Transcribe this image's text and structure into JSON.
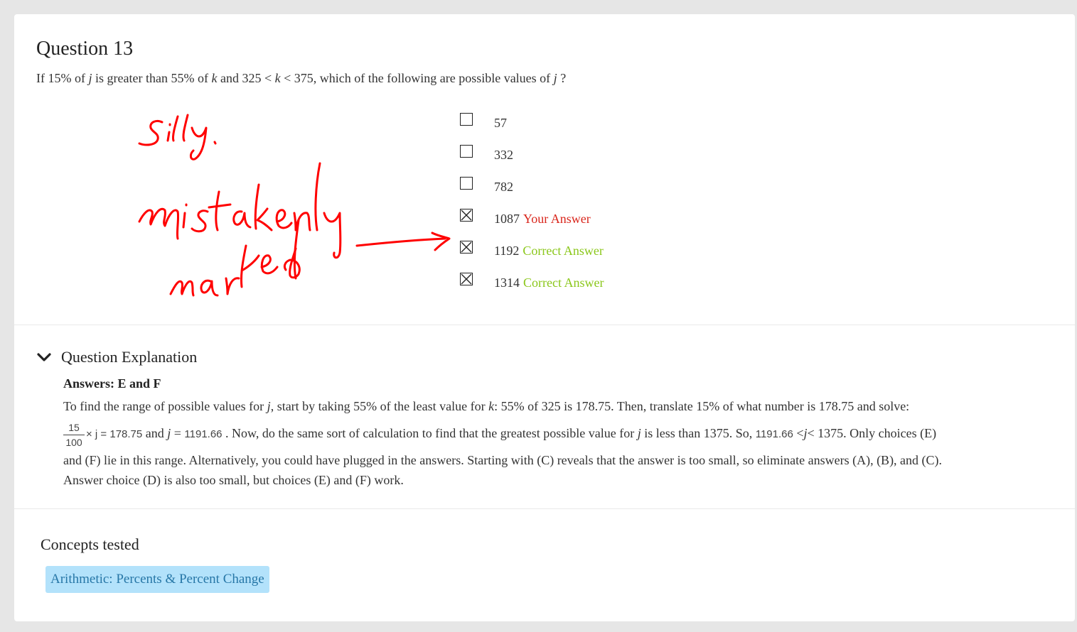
{
  "question": {
    "title": "Question 13",
    "stem_parts": [
      "If 15% of ",
      "j",
      " is greater than 55% of ",
      "k",
      " and 325 < ",
      "k",
      " < 375, which of the following are possible values of ",
      "j",
      " ?"
    ]
  },
  "choices": [
    {
      "value": "57",
      "checked": false,
      "tag": "",
      "tag_type": ""
    },
    {
      "value": "332",
      "checked": false,
      "tag": "",
      "tag_type": ""
    },
    {
      "value": "782",
      "checked": false,
      "tag": "",
      "tag_type": ""
    },
    {
      "value": "1087",
      "checked": true,
      "tag": "Your Answer",
      "tag_type": "your"
    },
    {
      "value": "1192",
      "checked": true,
      "tag": "Correct Answer",
      "tag_type": "correct"
    },
    {
      "value": "1314",
      "checked": true,
      "tag": "Correct Answer",
      "tag_type": "correct"
    }
  ],
  "annotation": {
    "handwriting": [
      "silly.",
      "mistakenly",
      "marked"
    ],
    "color": "#ff0000"
  },
  "explanation": {
    "toggle_label": "Question Explanation",
    "answers": "Answers: E and F",
    "line1_parts": [
      "To find the range of possible values for ",
      "j",
      ", start by taking 55% of the least value for ",
      "k",
      ": 55% of 325 is 178.75. Then, translate 15% of what number is 178.75 and solve:"
    ],
    "frac_num": "15",
    "frac_den": "100",
    "math1": "× j = 178.75",
    "text_and": " and ",
    "j": "j",
    "eq": " = ",
    "math_val": "1191.66",
    "line2_mid": " . Now, do the same sort of calculation to find that the greatest possible value for ",
    "line2_mid2": " is less than 1375. So, ",
    "lt": " <",
    "line2_end": "< 1375. Only choices (E)",
    "line3": "and (F) lie in this range. Alternatively, you could have plugged in the answers. Starting with (C) reveals that the answer is too small, so eliminate answers (A), (B), and (C).",
    "line4": "Answer choice (D) is also too small, but choices (E) and (F) work."
  },
  "concepts": {
    "title": "Concepts tested",
    "items": [
      "Arithmetic: Percents & Percent Change"
    ]
  },
  "colors": {
    "your_answer": "#d9261c",
    "correct_answer": "#8bc71b",
    "chip_bg": "#b3e2fb",
    "chip_text": "#2777a7"
  }
}
